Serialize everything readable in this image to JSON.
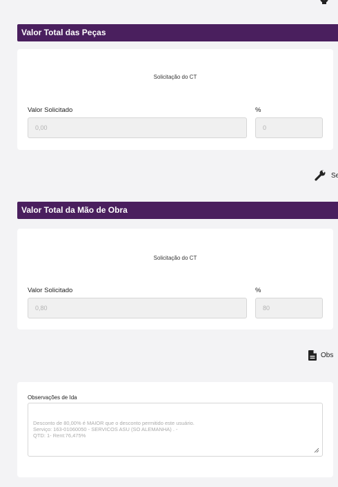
{
  "icons": {
    "gear": "gear-icon",
    "wrench": "wrench-icon",
    "document": "document-icon"
  },
  "colors": {
    "header_bg": "#4a1f5e",
    "page_bg": "#f3f3f5",
    "input_bg": "#f0f0f0"
  },
  "parts": {
    "header": "Valor Total das Peças",
    "card_title": "Solicitação do CT",
    "value_label": "Valor Solicitado",
    "value": "0,00",
    "percent_label": "%",
    "percent": "0"
  },
  "services_link": "Se",
  "labor": {
    "header": "Valor Total da Mão de Obra",
    "card_title": "Solicitação do CT",
    "value_label": "Valor Solicitado",
    "value": "0,80",
    "percent_label": "%",
    "percent": "80"
  },
  "observations_link": "Obs",
  "observations": {
    "label": "Observações de Ida",
    "text": "Desconto de 80,00% é MAIOR que o desconto permitido este usuário.\nServiço: 163-01060050 - SERVICOS ASU (SO ALEMANHA) . -\n QTD: 1- Rent:76,475%"
  }
}
